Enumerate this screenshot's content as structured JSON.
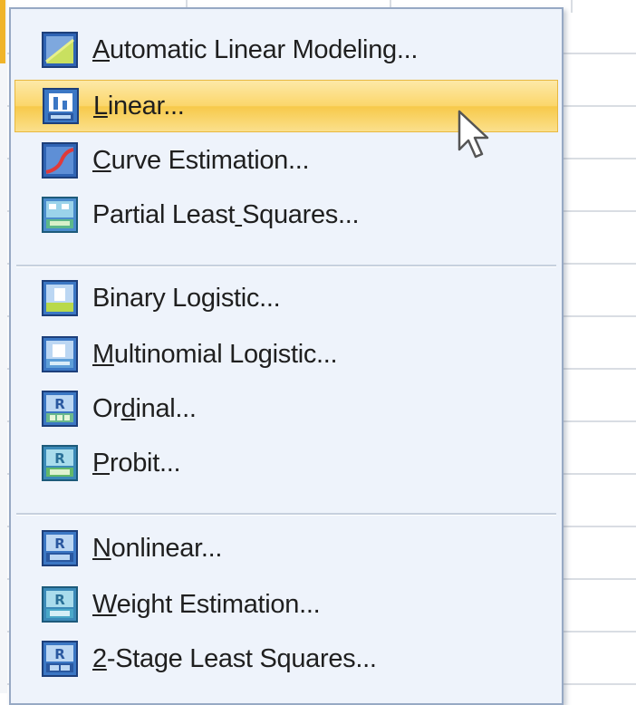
{
  "menu": {
    "items": [
      {
        "label": "Automatic Linear Modeling...",
        "mnemonic_index": 0,
        "icon": "automatic-linear-modeling-icon",
        "highlighted": false
      },
      {
        "label": "Linear...",
        "mnemonic_index": 0,
        "icon": "linear-regression-icon",
        "highlighted": true
      },
      {
        "label": "Curve Estimation...",
        "mnemonic_index": 0,
        "icon": "curve-estimation-icon",
        "highlighted": false
      },
      {
        "label": "Partial Least Squares...",
        "mnemonic_index": 13,
        "icon": "partial-least-squares-icon",
        "highlighted": false
      },
      {
        "label": "Binary Logistic...",
        "mnemonic_index": 9,
        "icon": "binary-logistic-icon",
        "highlighted": false
      },
      {
        "label": "Multinomial Logistic...",
        "mnemonic_index": 0,
        "icon": "multinomial-logistic-icon",
        "highlighted": false
      },
      {
        "label": "Ordinal...",
        "mnemonic_index": 2,
        "icon": "ordinal-regression-icon",
        "highlighted": false
      },
      {
        "label": "Probit...",
        "mnemonic_index": 0,
        "icon": "probit-icon",
        "highlighted": false
      },
      {
        "label": "Nonlinear...",
        "mnemonic_index": 0,
        "icon": "nonlinear-regression-icon",
        "highlighted": false
      },
      {
        "label": "Weight Estimation...",
        "mnemonic_index": 0,
        "icon": "weight-estimation-icon",
        "highlighted": false
      },
      {
        "label": "2-Stage Least Squares...",
        "mnemonic_index": 0,
        "icon": "two-stage-least-squares-icon",
        "highlighted": false
      }
    ]
  },
  "colors": {
    "menu_background": "#eef3fb",
    "menu_border": "#97a9c4",
    "highlight": "#fbd66a",
    "text": "#1f1f1f"
  }
}
